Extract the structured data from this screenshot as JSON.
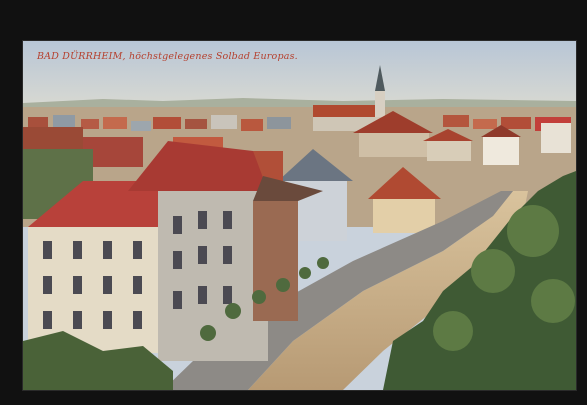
{
  "postcard": {
    "caption": "BAD DÜRRHEIM, höchstgelegenes Solbad Europas.",
    "caption_color": "#b5402e"
  }
}
